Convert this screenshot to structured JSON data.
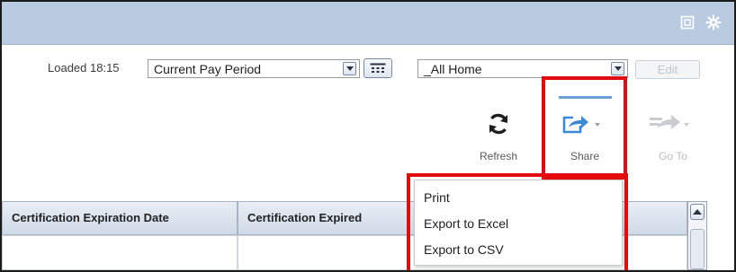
{
  "header": {
    "icons": [
      "window-icon",
      "gear-icon"
    ]
  },
  "filters": {
    "loaded_label": "Loaded 18:15",
    "pay_period": "Current Pay Period",
    "location": "_All Home",
    "edit_label": "Edit"
  },
  "toolbar": {
    "refresh_label": "Refresh",
    "share_label": "Share",
    "goto_label": "Go To"
  },
  "share_menu": {
    "items": [
      "Print",
      "Export to Excel",
      "Export to CSV"
    ]
  },
  "table": {
    "columns": [
      "Certification Expiration Date",
      "Certification Expired"
    ]
  },
  "colors": {
    "highlight": "#e30b0b",
    "header_bar": "#b9cbe0",
    "accent": "#3a8ad6"
  }
}
